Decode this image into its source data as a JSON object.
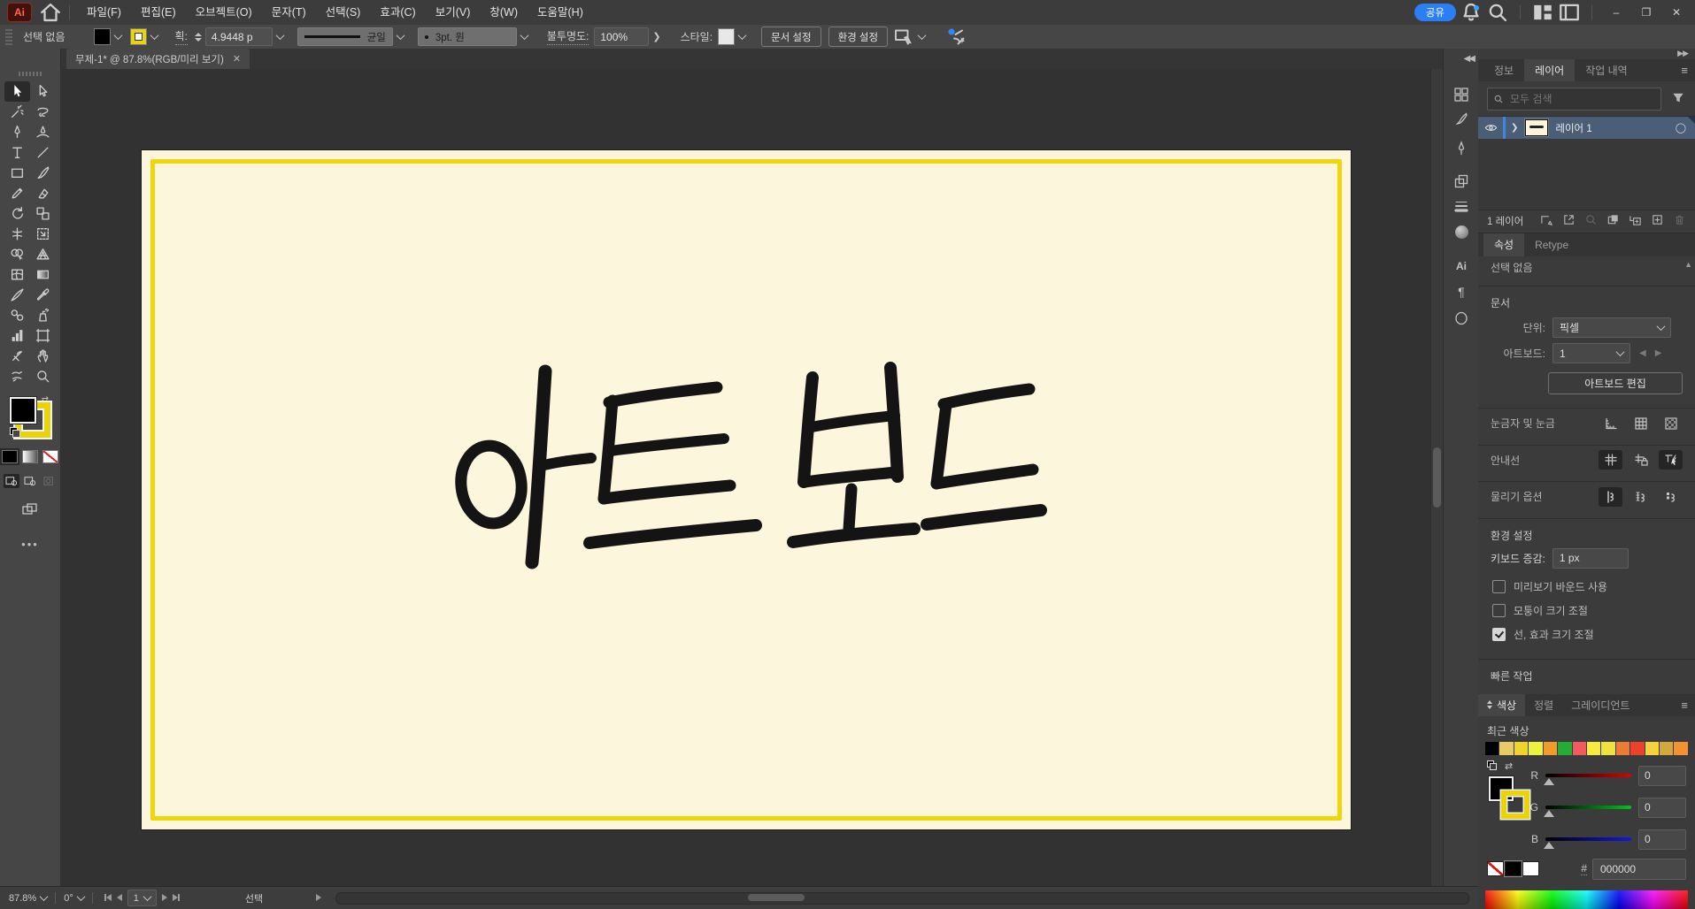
{
  "window": {
    "share_label": "공유"
  },
  "menubar": {
    "items": [
      "파일(F)",
      "편집(E)",
      "오브젝트(O)",
      "문자(T)",
      "선택(S)",
      "효과(C)",
      "보기(V)",
      "창(W)",
      "도움말(H)"
    ]
  },
  "controlbar": {
    "selection_status": "선택 없음",
    "stroke_label": "획:",
    "stroke_weight": "4.9448 p",
    "stroke_profile": "균일",
    "brush_definition": "3pt. 원",
    "opacity_label": "불투명도:",
    "opacity_value": "100%",
    "style_label": "스타일:",
    "document_setup_button": "문서 설정",
    "preferences_button": "환경 설정"
  },
  "document_tab": {
    "title": "무제-1* @ 87.8%(RGB/미리 보기)"
  },
  "artboard": {
    "text": "아트보드",
    "background_color": "#FCF6DC",
    "border_color": "#F0D50A"
  },
  "tool_icons": [
    "selection",
    "direct-selection",
    "magic-wand",
    "lasso",
    "pen",
    "curvature",
    "type",
    "line-segment",
    "rectangle",
    "paintbrush",
    "pencil",
    "eraser",
    "rotate",
    "scale",
    "width",
    "free-transform",
    "shape-builder",
    "perspective-grid",
    "mesh",
    "gradient",
    "knife",
    "eyedropper",
    "blend",
    "symbol-sprayer",
    "column-graph",
    "artboard",
    "slice",
    "hand",
    "warp",
    "zoom"
  ],
  "collapsed_panel_icons": [
    "swatches",
    "brush",
    "pen-panel",
    "stacked-squares",
    "stroke-lines",
    "sphere",
    "character",
    "paragraph",
    "opentype-o"
  ],
  "right_panel": {
    "panel_tabs": [
      "정보",
      "레이어",
      "작업 내역"
    ],
    "layers": {
      "search_placeholder": "모두 검색",
      "layer_name": "레이어 1",
      "footer_count": "1 레이어"
    },
    "properties": {
      "tabs": [
        "속성",
        "Retype"
      ],
      "no_selection": "선택 없음",
      "document": {
        "title": "문서",
        "unit_label": "단위:",
        "unit_value": "픽셀",
        "artboard_label": "아트보드:",
        "artboard_value": "1",
        "edit_artboard_button": "아트보드 편집"
      },
      "rulers_label": "눈금자 및 눈금",
      "guides_label": "안내선",
      "snap_label": "물리기 옵션",
      "preferences": {
        "title": "환경 설정",
        "keyboard_increment_label": "키보드 증감:",
        "keyboard_increment_value": "1 px",
        "checkboxes": [
          {
            "label": "미리보기 바운드 사용",
            "checked": false
          },
          {
            "label": "모퉁이 크기 조절",
            "checked": false
          },
          {
            "label": "선, 효과 크기 조절",
            "checked": true
          }
        ]
      },
      "quick_actions_label": "빠른 작업"
    },
    "color": {
      "tabs": [
        "색상",
        "정렬",
        "그레이디언트"
      ],
      "recent_label": "최근 색상",
      "recent_colors": [
        "#000000",
        "#E9CA68",
        "#F0D32B",
        "#EDF23E",
        "#F29B28",
        "#23AC38",
        "#F25A60",
        "#F6EC3F",
        "#F0E23C",
        "#EE7B35",
        "#E8432E",
        "#F6D23C",
        "#D2A73B",
        "#F2932F"
      ],
      "channels": [
        {
          "label": "R",
          "value": "0"
        },
        {
          "label": "G",
          "value": "0"
        },
        {
          "label": "B",
          "value": "0"
        }
      ],
      "hex_value": "000000"
    }
  },
  "statusbar": {
    "zoom": "87.8%",
    "rotation": "0°",
    "artboard_number": "1",
    "tool_status": "선택"
  }
}
